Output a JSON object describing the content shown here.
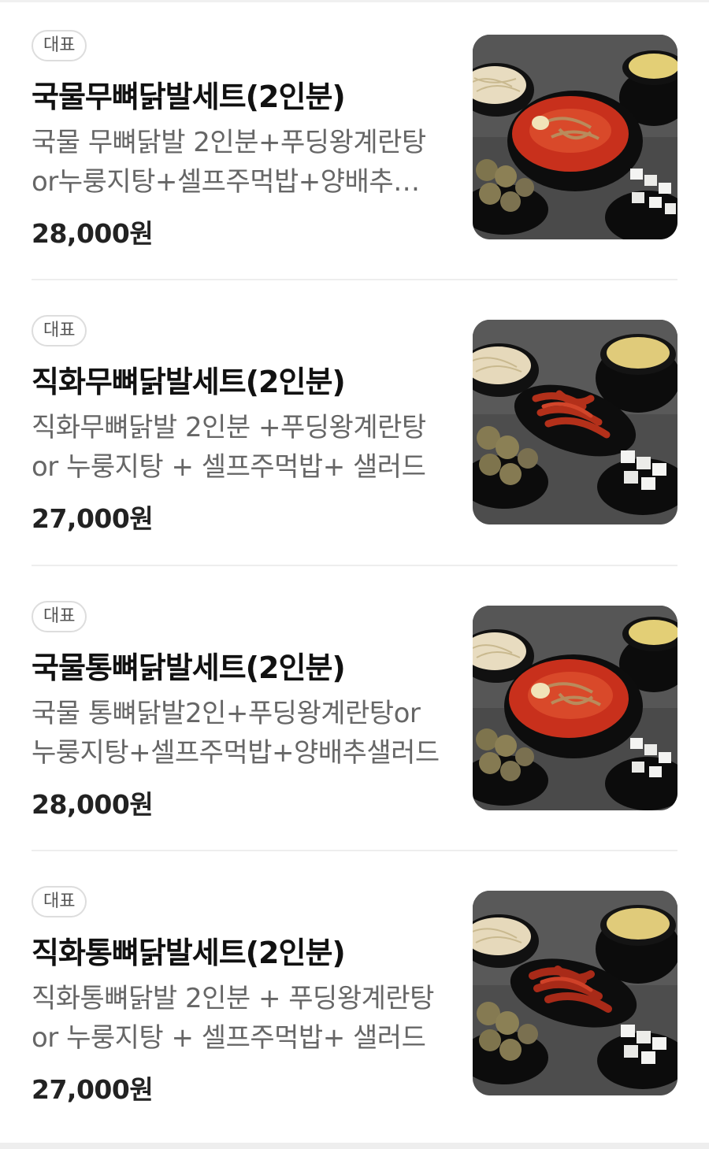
{
  "menu": {
    "items": [
      {
        "badge": "대표",
        "name": "국물무뼈닭발세트(2인분)",
        "description": "국물 무뼈닭발 2인분+푸딩왕계란탕or누룽지탕+셀프주먹밥+양배추샐러드",
        "price": "28,000원",
        "photo": "soup-set-photo"
      },
      {
        "badge": "대표",
        "name": "직화무뼈닭발세트(2인분)",
        "description": "직화무뼈닭발 2인분 +푸딩왕계란탕 or 누룽지탕 + 셀프주먹밥+ 샐러드",
        "price": "27,000원",
        "photo": "grilled-set-photo"
      },
      {
        "badge": "대표",
        "name": "국물통뼈닭발세트(2인분)",
        "description": "국물 통뼈닭발2인+푸딩왕계란탕or누룽지탕+셀프주먹밥+양배추샐러드",
        "price": "28,000원",
        "photo": "soup-set-photo"
      },
      {
        "badge": "대표",
        "name": "직화통뼈닭발세트(2인분)",
        "description": "직화통뼈닭발 2인분 + 푸딩왕계란탕 or 누룽지탕 + 셀프주먹밥+ 샐러드",
        "price": "27,000원",
        "photo": "grilled-set-photo"
      }
    ]
  },
  "colors": {
    "background": "#ffffff",
    "text_primary": "#111111",
    "text_secondary": "#666666",
    "badge_border": "#dddddd",
    "divider": "#eeeeee",
    "sauce_red": "#c8301c"
  }
}
